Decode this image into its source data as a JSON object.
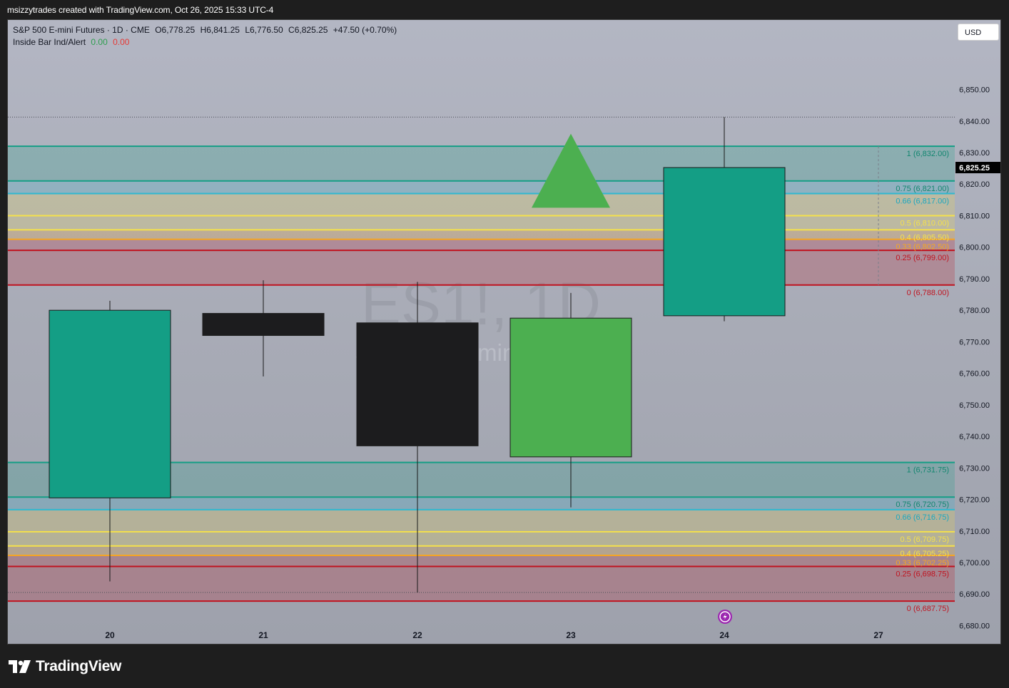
{
  "attribution": "msizzytrades created with TradingView.com, Oct 26, 2025 15:33 UTC-4",
  "header": {
    "symbol": "S&P 500 E-mini Futures · 1D · CME",
    "open": "O6,778.25",
    "high": "H6,841.25",
    "low": "L6,776.50",
    "close": "C6,825.25",
    "change": "+47.50 (+0.70%)",
    "indicator_name": "Inside Bar Ind/Alert",
    "indicator_value_1": "0.00",
    "indicator_value_2": "0.00"
  },
  "currency_button": "USD",
  "watermark": {
    "ticker": "ES1!, 1D",
    "name": "S&P 500 E-mini Futures"
  },
  "brand": {
    "name": "TradingView",
    "logo_icon": "tradingview-logo-icon"
  },
  "colors": {
    "teal": "#149e85",
    "cyan": "#2fb8d0",
    "yellow": "#f5e14b",
    "orange": "#f5a623",
    "red": "#c0131f",
    "green_candle": "#4caf50",
    "black_candle": "#1c1c1e",
    "triangle": "#4caf50",
    "flash_icon": "#9c27b0"
  },
  "chart_data": {
    "type": "candlestick",
    "x_categories": [
      "20",
      "21",
      "22",
      "23",
      "24",
      "27"
    ],
    "ylim": [
      6674,
      6856
    ],
    "y_ticks": [
      "6,680.00",
      "6,690.00",
      "6,700.00",
      "6,710.00",
      "6,720.00",
      "6,730.00",
      "6,740.00",
      "6,750.00",
      "6,760.00",
      "6,770.00",
      "6,780.00",
      "6,790.00",
      "6,800.00",
      "6,810.00",
      "6,820.00",
      "6,830.00",
      "6,840.00",
      "6,850.00"
    ],
    "y_tick_values": [
      6680,
      6690,
      6700,
      6710,
      6720,
      6730,
      6740,
      6750,
      6760,
      6770,
      6780,
      6790,
      6800,
      6810,
      6820,
      6830,
      6840,
      6850
    ],
    "last_price_label": "6,825.25",
    "last_price": 6825.25,
    "candles": [
      {
        "x": "20",
        "open": 6720.5,
        "high": 6783.0,
        "low": 6694.0,
        "close": 6780.0,
        "color": "teal"
      },
      {
        "x": "21",
        "open": 6779.0,
        "high": 6789.5,
        "low": 6759.0,
        "close": 6772.0,
        "color": "black"
      },
      {
        "x": "22",
        "open": 6776.0,
        "high": 6789.0,
        "low": 6690.5,
        "close": 6737.0,
        "color": "black"
      },
      {
        "x": "23",
        "open": 6733.5,
        "high": 6785.5,
        "low": 6717.5,
        "close": 6777.5,
        "color": "green"
      },
      {
        "x": "24",
        "open": 6778.25,
        "high": 6841.25,
        "low": 6776.5,
        "close": 6825.25,
        "color": "teal"
      }
    ],
    "signal_marker": {
      "x": "23",
      "shape": "triangle-up",
      "top": 6836.0,
      "bottom": 6812.5
    },
    "fib_sets": [
      {
        "levels": [
          {
            "ratio": "1",
            "price": 6832.0,
            "label": "1 (6,832.00)",
            "color": "teal"
          },
          {
            "ratio": "0.75",
            "price": 6821.0,
            "label": "0.75 (6,821.00)",
            "color": "teal"
          },
          {
            "ratio": "0.66",
            "price": 6817.0,
            "label": "0.66 (6,817.00)",
            "color": "cyan"
          },
          {
            "ratio": "0.5",
            "price": 6810.0,
            "label": "0.5 (6,810.00)",
            "color": "yellow"
          },
          {
            "ratio": "0.4",
            "price": 6805.5,
            "label": "0.4 (6,805.50)",
            "color": "yellow"
          },
          {
            "ratio": "0.33",
            "price": 6802.5,
            "label": "0.33 (6,802.50)",
            "color": "orange"
          },
          {
            "ratio": "0.25",
            "price": 6799.0,
            "label": "0.25 (6,799.00)",
            "color": "red"
          },
          {
            "ratio": "0",
            "price": 6788.0,
            "label": "0 (6,788.00)",
            "color": "red"
          }
        ]
      },
      {
        "levels": [
          {
            "ratio": "1",
            "price": 6731.75,
            "label": "1 (6,731.75)",
            "color": "teal"
          },
          {
            "ratio": "0.75",
            "price": 6720.75,
            "label": "0.75 (6,720.75)",
            "color": "teal"
          },
          {
            "ratio": "0.66",
            "price": 6716.75,
            "label": "0.66 (6,716.75)",
            "color": "cyan"
          },
          {
            "ratio": "0.5",
            "price": 6709.75,
            "label": "0.5 (6,709.75)",
            "color": "yellow"
          },
          {
            "ratio": "0.4",
            "price": 6705.25,
            "label": "0.4 (6,705.25)",
            "color": "yellow"
          },
          {
            "ratio": "0.33",
            "price": 6702.25,
            "label": "0.33 (6,702.25)",
            "color": "orange"
          },
          {
            "ratio": "0.25",
            "price": 6698.75,
            "label": "0.25 (6,698.75)",
            "color": "red"
          },
          {
            "ratio": "0",
            "price": 6687.75,
            "label": "0 (6,687.75)",
            "color": "red"
          }
        ]
      }
    ],
    "dotted_reference_lines": [
      6841.25,
      6690.5
    ]
  }
}
